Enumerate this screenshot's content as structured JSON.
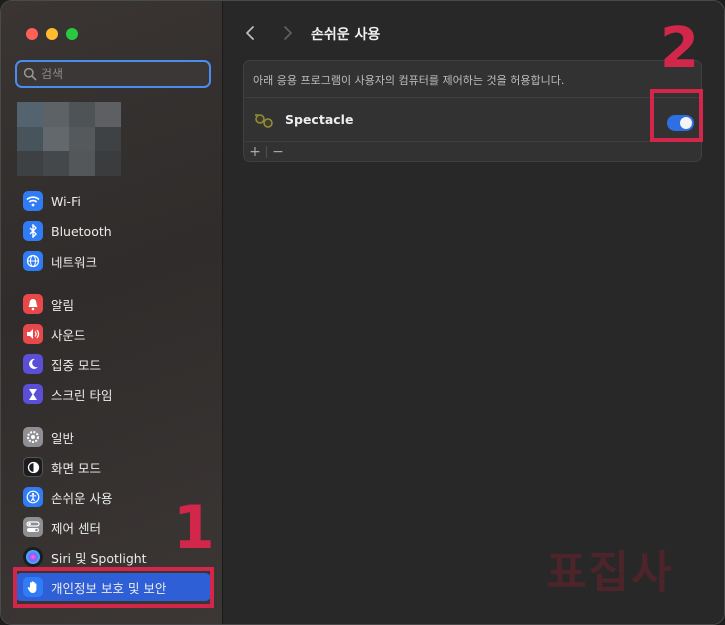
{
  "sidebar": {
    "search_placeholder": "검색",
    "items": [
      {
        "label": "Wi-Fi",
        "icon": "wifi-icon",
        "color": "#2f7cf6"
      },
      {
        "label": "Bluetooth",
        "icon": "bluetooth-icon",
        "color": "#2f7cf6"
      },
      {
        "label": "네트워크",
        "icon": "globe-icon",
        "color": "#2f7cf6"
      },
      {
        "label": "알림",
        "icon": "bell-icon",
        "color": "#e8484a"
      },
      {
        "label": "사운드",
        "icon": "speaker-icon",
        "color": "#e8484a"
      },
      {
        "label": "집중 모드",
        "icon": "moon-icon",
        "color": "#5a4fd6"
      },
      {
        "label": "스크린 타임",
        "icon": "hourglass-icon",
        "color": "#5a4fd6"
      },
      {
        "label": "일반",
        "icon": "gear-icon",
        "color": "#8e8e93"
      },
      {
        "label": "화면 모드",
        "icon": "appearance-icon",
        "color": "#1c1c1e"
      },
      {
        "label": "손쉬운 사용",
        "icon": "accessibility-icon",
        "color": "#2f7cf6"
      },
      {
        "label": "제어 센터",
        "icon": "control-center-icon",
        "color": "#8e8e93"
      },
      {
        "label": "Siri 및 Spotlight",
        "icon": "siri-icon",
        "color": "#1c1c1e"
      },
      {
        "label": "개인정보 보호 및 보안",
        "icon": "hand-icon",
        "color": "#2f7cf6",
        "selected": true
      }
    ]
  },
  "main": {
    "title": "손쉬운 사용",
    "description": "아래 응용 프로그램이 사용자의 컴퓨터를 제어하는 것을 허용합니다.",
    "apps": [
      {
        "name": "Spectacle",
        "enabled": true
      }
    ],
    "add_label": "+",
    "remove_label": "−"
  },
  "annotations": {
    "num1": "1",
    "num2": "2",
    "color": "#d2264a"
  },
  "watermark": "표집사",
  "colors": {
    "accent": "#2f6fe4"
  }
}
